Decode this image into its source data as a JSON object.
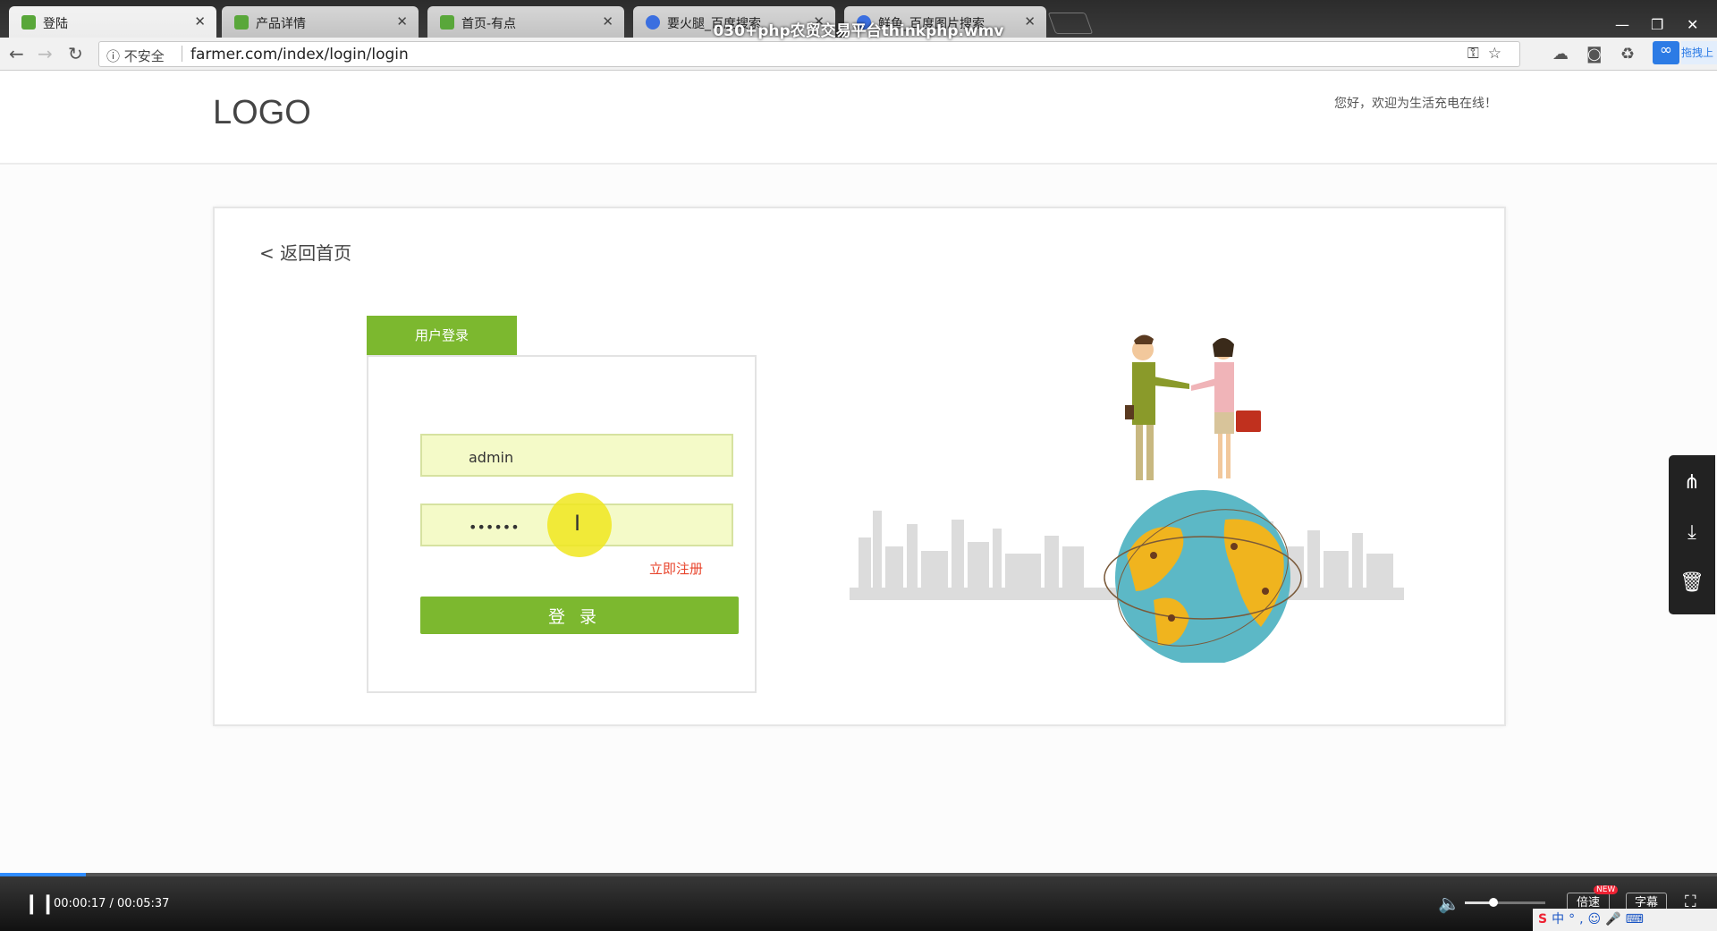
{
  "video_title": "030+php农贸交易平台thinkphp.wmv",
  "browser": {
    "tabs": [
      {
        "title": "登陆",
        "favicon_color": "#59a73a"
      },
      {
        "title": "产品详情",
        "favicon_color": "#59a73a"
      },
      {
        "title": "首页-有点",
        "favicon_color": "#59a73a"
      },
      {
        "title": "要火腿_百度搜索",
        "favicon_color": "#3b6fe0"
      },
      {
        "title": "鲜鱼_百度图片搜索",
        "favicon_color": "#3b6fe0"
      }
    ],
    "security_label": "不安全",
    "url": "farmer.com/index/login/login",
    "ext_label": "拖拽上"
  },
  "header": {
    "logo": "LOGO",
    "welcome": "您好，欢迎为生活充电在线！"
  },
  "card": {
    "back_link": "< 返回首页",
    "login_tab": "用户登录",
    "username_value": "admin",
    "password_value": "••••••",
    "register_link": "立即注册",
    "submit_label": "登录"
  },
  "player": {
    "time": "00:00:17 / 00:05:37",
    "progress_fraction": 0.05,
    "volume_fraction": 0.35,
    "speed_label": "倍速",
    "new_badge": "NEW",
    "subtitle_label": "字幕"
  },
  "taskbar": {
    "ime_text": "中"
  },
  "colors": {
    "brand_green": "#7cb82f",
    "register_red": "#e8442c",
    "field_bg": "#f4fac8"
  }
}
